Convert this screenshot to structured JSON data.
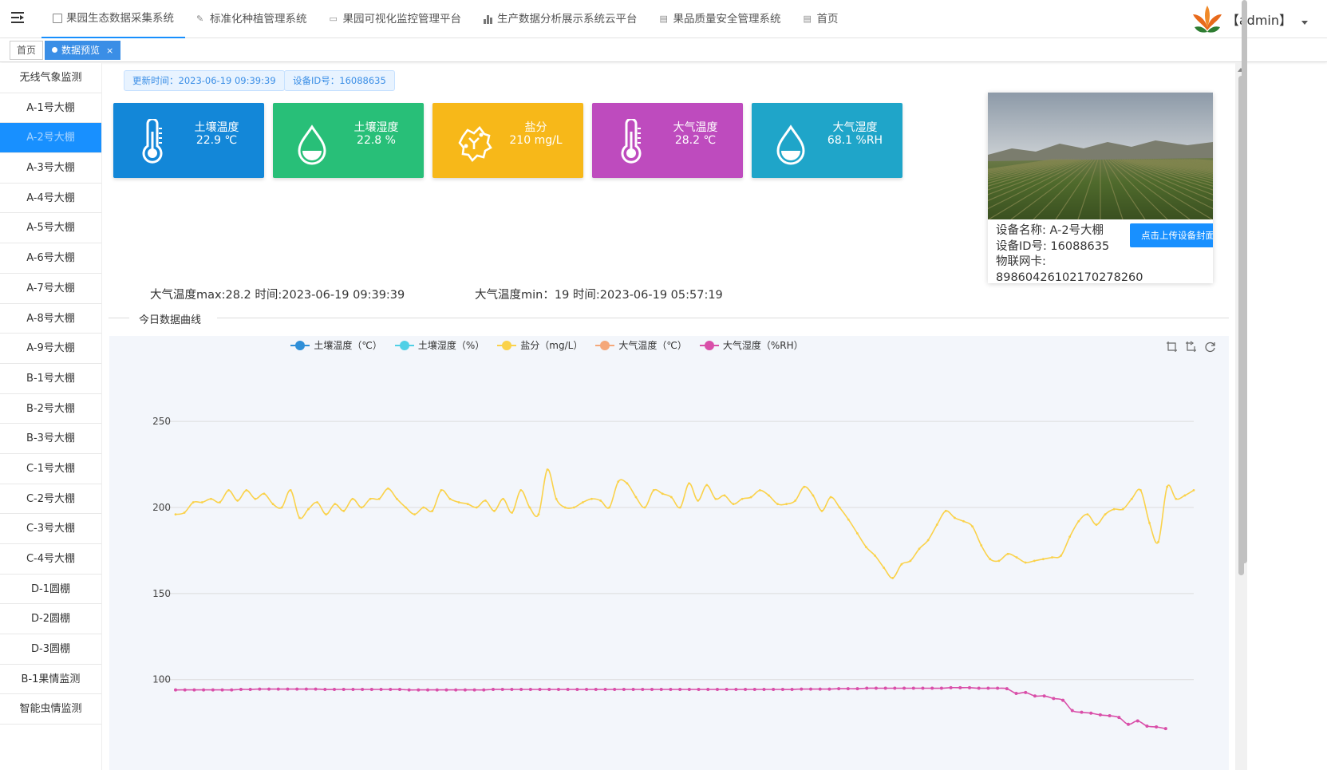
{
  "navbar": {
    "items": [
      {
        "label": "果园生态数据采集系统",
        "icon": "book-icon"
      },
      {
        "label": "标准化种植管理系统",
        "icon": "edit-icon"
      },
      {
        "label": "果园可视化监控管理平台",
        "icon": "monitor-icon"
      },
      {
        "label": "生产数据分析展示系统云平台",
        "icon": "bar-chart-icon"
      },
      {
        "label": "果品质量安全管理系统",
        "icon": "table-icon"
      },
      {
        "label": "首页",
        "icon": "table-icon"
      }
    ],
    "active_index": 0,
    "user": "【admin】"
  },
  "tags": {
    "home": "首页",
    "current": "数据预览",
    "close": "×"
  },
  "sidebar": {
    "items": [
      "无线气象监测",
      "A-1号大棚",
      "A-2号大棚",
      "A-3号大棚",
      "A-4号大棚",
      "A-5号大棚",
      "A-6号大棚",
      "A-7号大棚",
      "A-8号大棚",
      "A-9号大棚",
      "B-1号大棚",
      "B-2号大棚",
      "B-3号大棚",
      "C-1号大棚",
      "C-2号大棚",
      "C-3号大棚",
      "C-4号大棚",
      "D-1圆棚",
      "D-2圆棚",
      "D-3圆棚",
      "B-1果情监测",
      "智能虫情监测"
    ],
    "active_index": 2,
    "active_color": "#1890ff"
  },
  "info": {
    "update_time": "更新时间：2023-06-19 09:39:39",
    "device_id": "设备ID号：16088635"
  },
  "cards": [
    {
      "title": "土壤温度",
      "value": "22.9 ℃",
      "color": "#1387d8",
      "icon": "thermometer-icon"
    },
    {
      "title": "土壤湿度",
      "value": "22.8 %",
      "color": "#28bf78",
      "icon": "water-drop-icon"
    },
    {
      "title": "盐分",
      "value": "210 mg/L",
      "color": "#f7b819",
      "icon": "salt-crystal-icon"
    },
    {
      "title": "大气温度",
      "value": "28.2 ℃",
      "color": "#be4bbe",
      "icon": "thermometer-icon"
    },
    {
      "title": "大气湿度",
      "value": "68.1 %RH",
      "color": "#1fa5c9",
      "icon": "water-drop-icon"
    }
  ],
  "device": {
    "name": "设备名称: A-2号大棚",
    "id": "设备ID号: 16088635",
    "iot_label": "物联网卡:",
    "iot_value": "89860426102170278260",
    "upload_button": "点击上传设备封面"
  },
  "stats": {
    "max": "大气温度max:28.2 时间:2023-06-19 09:39:39",
    "min": "大气温度min：19 时间:2023-06-19 05:57:19"
  },
  "section_title": "今日数据曲线",
  "chart_data": {
    "type": "line",
    "title": "",
    "legend": [
      {
        "name": "土壤温度（℃）",
        "color": "#2f8fd8"
      },
      {
        "name": "土壤湿度（%）",
        "color": "#4fd0e6"
      },
      {
        "name": "盐分（mg/L）",
        "color": "#fad24b"
      },
      {
        "name": "大气温度（℃）",
        "color": "#f5a87a"
      },
      {
        "name": "大气湿度（%RH）",
        "color": "#d94fa9"
      }
    ],
    "legend_position": "top",
    "y_ticks": [
      100,
      150,
      200,
      250
    ],
    "ylim_visible": [
      70,
      265
    ],
    "grid": true,
    "series": [
      {
        "name": "盐分（mg/L）",
        "color": "#fad24b",
        "values": [
          196,
          197,
          203,
          203,
          205,
          203,
          210,
          204,
          210,
          205,
          208,
          202,
          200,
          210,
          194,
          199,
          203,
          196,
          202,
          198,
          205,
          200,
          205,
          205,
          211,
          205,
          200,
          196,
          200,
          198,
          210,
          205,
          203,
          202,
          200,
          204,
          198,
          205,
          197,
          210,
          200,
          196,
          222,
          205,
          200,
          200,
          203,
          205,
          204,
          200,
          215,
          214,
          206,
          200,
          210,
          208,
          206,
          200,
          214,
          204,
          213,
          205,
          207,
          202,
          205,
          206,
          210,
          207,
          202,
          202,
          204,
          212,
          207,
          198,
          206,
          200,
          193,
          185,
          177,
          172,
          165,
          159,
          167,
          169,
          176,
          181,
          190,
          198,
          194,
          192,
          189,
          178,
          170,
          169,
          173,
          171,
          168,
          169,
          170,
          171,
          172,
          183,
          192,
          196,
          190,
          196,
          199,
          199,
          205,
          210,
          191,
          180,
          212,
          205,
          207,
          210
        ],
        "note": "values estimated from plot"
      },
      {
        "name": "大气湿度（%RH）",
        "color": "#d94fa9",
        "values": [
          94,
          94,
          94,
          94,
          94,
          94,
          94,
          94.3,
          94.3,
          94.5,
          94.5,
          94.5,
          94.5,
          94.5,
          94.5,
          94.5,
          94.3,
          94.3,
          94.3,
          94.3,
          94.3,
          94.3,
          94.3,
          94.3,
          94.3,
          94,
          94,
          94,
          94,
          94,
          94,
          94,
          94,
          94,
          94.3,
          94.3,
          94.3,
          94.3,
          94.3,
          94.3,
          94.3,
          94.3,
          94.3,
          94.3,
          94.3,
          94.3,
          94.3,
          94.3,
          94.3,
          94.3,
          94.3,
          94.3,
          94.3,
          94.3,
          94.3,
          94.3,
          94.3,
          94.3,
          94.3,
          94.3,
          94.3,
          94.3,
          94.3,
          94.3,
          94.3,
          94.3,
          94.3,
          94.5,
          94.5,
          94.5,
          94.5,
          94.7,
          94.7,
          94.7,
          95,
          95,
          95,
          95,
          95,
          95,
          95,
          95,
          95,
          95.3,
          95.3,
          95.3,
          95,
          95,
          95,
          94.7,
          92,
          92.5,
          90.5,
          90.5,
          89,
          88,
          82,
          81,
          80.5,
          79.5,
          79,
          78,
          74,
          76,
          73,
          72.5,
          71.5
        ],
        "note": "values estimated from plot"
      }
    ]
  }
}
